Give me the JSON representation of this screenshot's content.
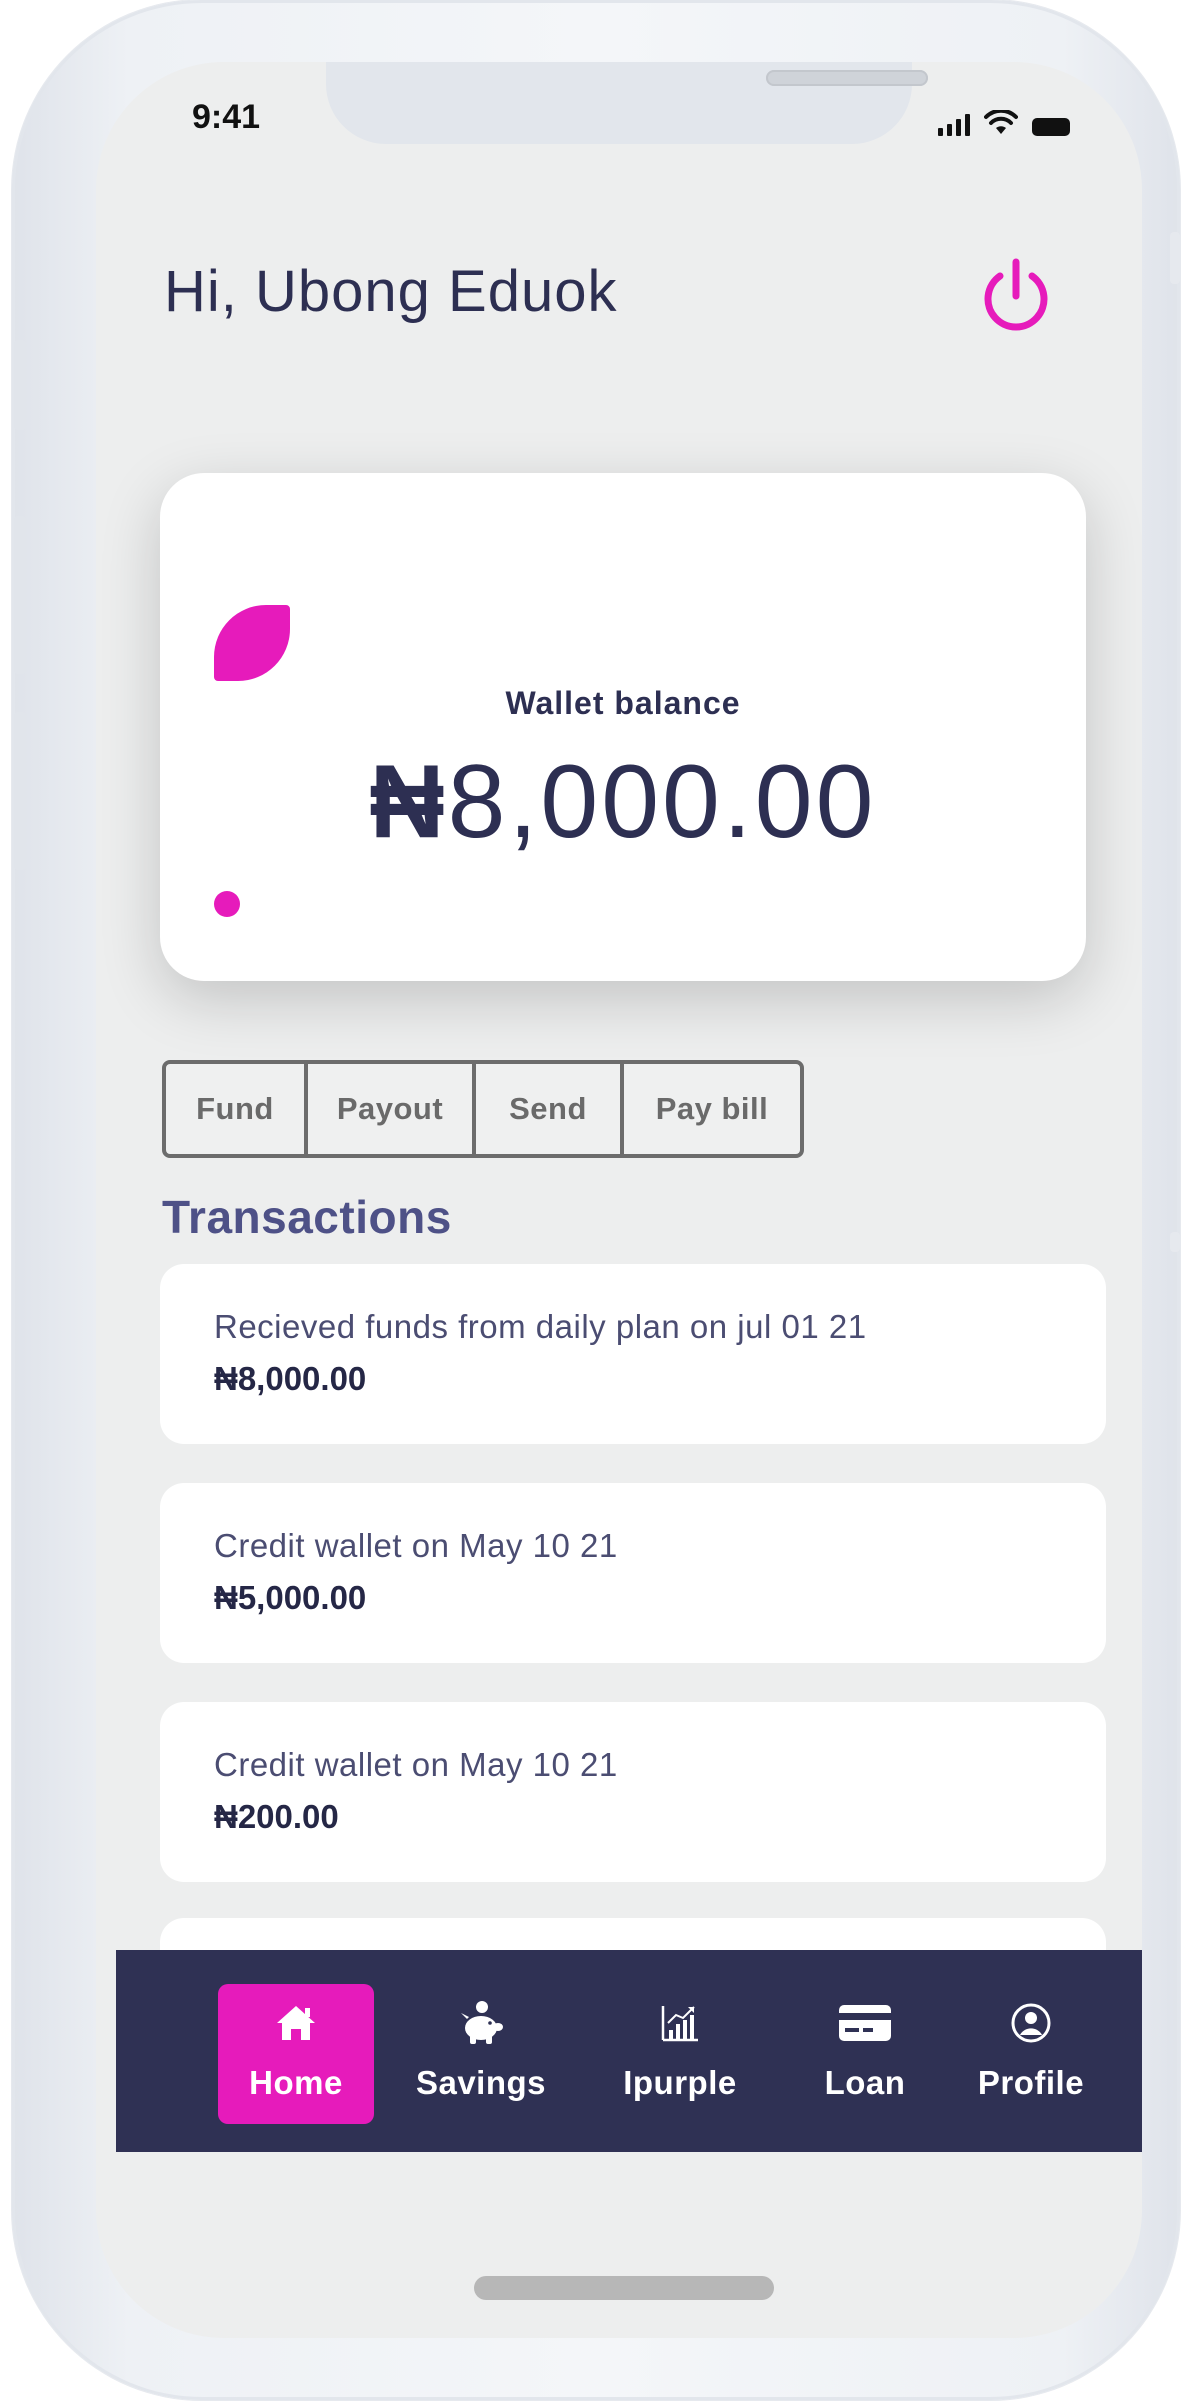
{
  "status_bar": {
    "time": "9:41"
  },
  "header": {
    "greeting": "Hi, Ubong Eduok",
    "power_icon": "power-icon"
  },
  "wallet": {
    "label": "Wallet balance",
    "currency": "₦",
    "amount": "8,000.00"
  },
  "actions": [
    "Fund",
    "Payout",
    "Send",
    "Pay bill"
  ],
  "transactions": {
    "title": "Transactions",
    "items": [
      {
        "description": "Recieved funds from daily plan on jul 01 21",
        "amount": "₦8,000.00"
      },
      {
        "description": "Credit wallet on May 10 21",
        "amount": "₦5,000.00"
      },
      {
        "description": "Credit wallet on May 10 21",
        "amount": "₦200.00"
      }
    ]
  },
  "tab_bar": {
    "tabs": [
      {
        "label": "Home",
        "icon": "home-icon",
        "active": true
      },
      {
        "label": "Savings",
        "icon": "piggy-bank-icon",
        "active": false
      },
      {
        "label": "Ipurple",
        "icon": "chart-icon",
        "active": false
      },
      {
        "label": "Loan",
        "icon": "credit-card-icon",
        "active": false
      },
      {
        "label": "Profile",
        "icon": "user-circle-icon",
        "active": false
      }
    ]
  },
  "colors": {
    "accent": "#e61bbb",
    "navy": "#2f3154",
    "text": "#2d2f52",
    "background": "#edeeee"
  }
}
